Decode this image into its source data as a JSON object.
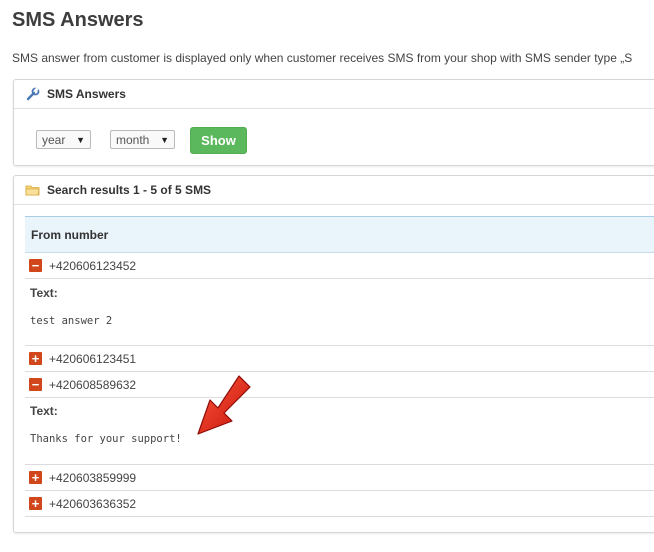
{
  "page": {
    "title": "SMS Answers",
    "description": "SMS answer from customer is displayed only when customer receives SMS from your shop with SMS sender type „S"
  },
  "filter_panel": {
    "title": "SMS Answers",
    "icon": "wrench-icon",
    "year_select": {
      "value": "year"
    },
    "month_select": {
      "value": "month"
    },
    "show_button": "Show"
  },
  "results_panel": {
    "title": "Search results 1 - 5 of 5 SMS",
    "icon": "folder-icon",
    "column_header": "From number",
    "text_label": "Text:",
    "rows": [
      {
        "number": "+420606123452",
        "expanded": true,
        "text": "test answer 2"
      },
      {
        "number": "+420606123451",
        "expanded": false
      },
      {
        "number": "+420608589632",
        "expanded": true,
        "text": "Thanks for your support!"
      },
      {
        "number": "+420603859999",
        "expanded": false
      },
      {
        "number": "+420603636352",
        "expanded": false
      }
    ]
  },
  "colors": {
    "show_button": "#5cb85c",
    "toggle": "#d2461b",
    "header_bg": "#eaf4fb",
    "arrow": "#e31e10"
  }
}
